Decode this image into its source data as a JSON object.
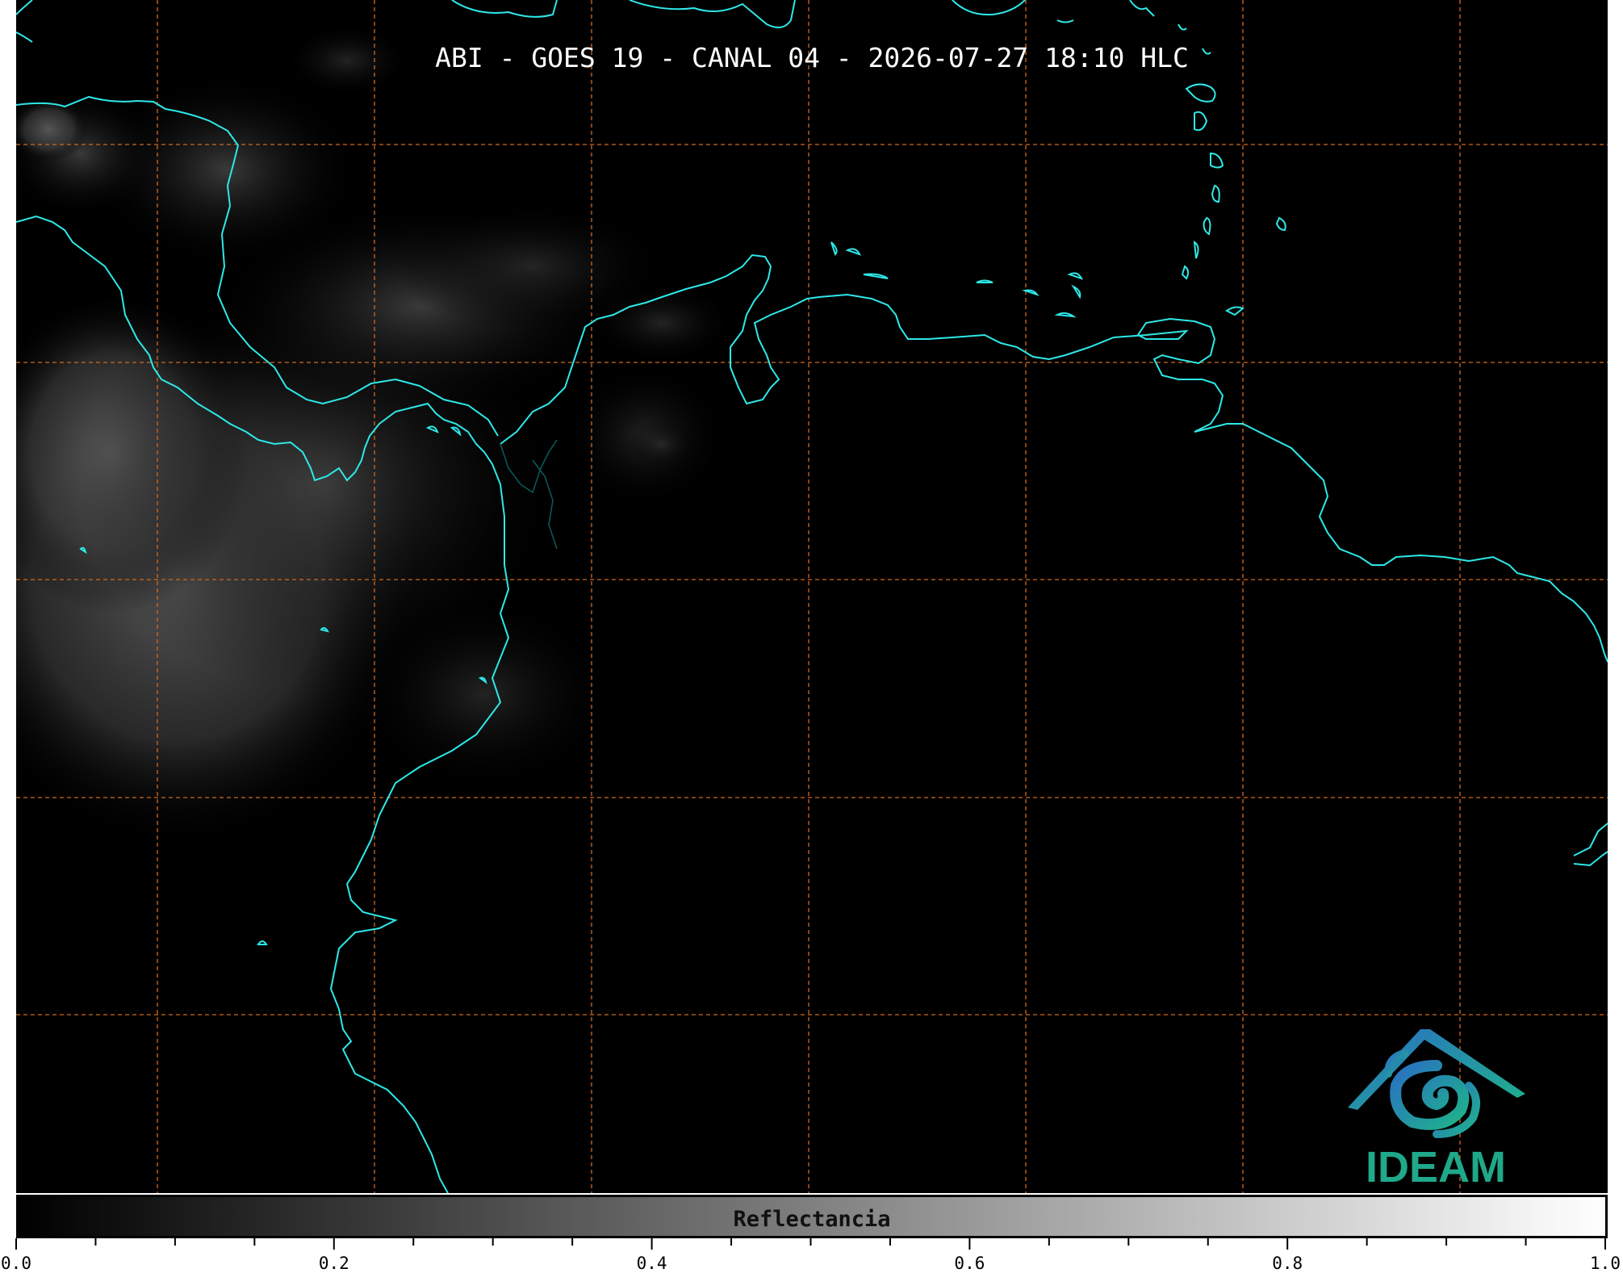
{
  "title": "ABI - GOES 19 - CANAL 04 - 2026-07-27 18:10 HLC",
  "colorbar": {
    "label": "Reflectancia",
    "min": 0.0,
    "max": 1.0,
    "tick_labels": [
      "0.0",
      "0.2",
      "0.4",
      "0.6",
      "0.8",
      "1.0"
    ],
    "cmap_start": "#000000",
    "cmap_end": "#ffffff"
  },
  "map": {
    "background": "#000000",
    "coastline_color": "#2ee8e8",
    "gridline_color": "#d2691e",
    "gridline_style": "dashed"
  },
  "logo": {
    "text": "IDEAM",
    "colors": [
      "#2a7fc4",
      "#1fa88a"
    ]
  }
}
